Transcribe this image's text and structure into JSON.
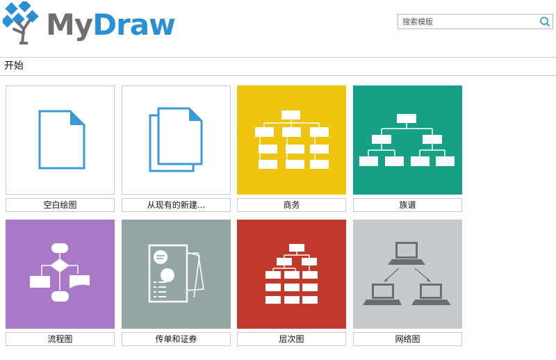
{
  "app": {
    "logo_part1": "My",
    "logo_part2": "Draw"
  },
  "search": {
    "placeholder": "搜索模版"
  },
  "section": {
    "title": "开始"
  },
  "templates": [
    {
      "label": "空白绘图",
      "color": "#ffffff",
      "icon": "blank-document-icon"
    },
    {
      "label": "从现有的新建...",
      "color": "#ffffff",
      "icon": "copy-documents-icon"
    },
    {
      "label": "商务",
      "color": "#f0c30f",
      "icon": "business-org-chart-icon"
    },
    {
      "label": "族谱",
      "color": "#16a085",
      "icon": "family-tree-icon"
    },
    {
      "label": "流程图",
      "color": "#a779c6",
      "icon": "flowchart-icon"
    },
    {
      "label": "传单和证券",
      "color": "#95a5a6",
      "icon": "flyer-icon"
    },
    {
      "label": "层次图",
      "color": "#c0392b",
      "icon": "hierarchy-chart-icon"
    },
    {
      "label": "网络图",
      "color": "#c7cacc",
      "icon": "network-diagram-icon"
    }
  ],
  "colors": {
    "brand_blue": "#2a8fd6",
    "brand_gray": "#6d6e71",
    "doc_icon_blue": "#3a9ad9"
  }
}
